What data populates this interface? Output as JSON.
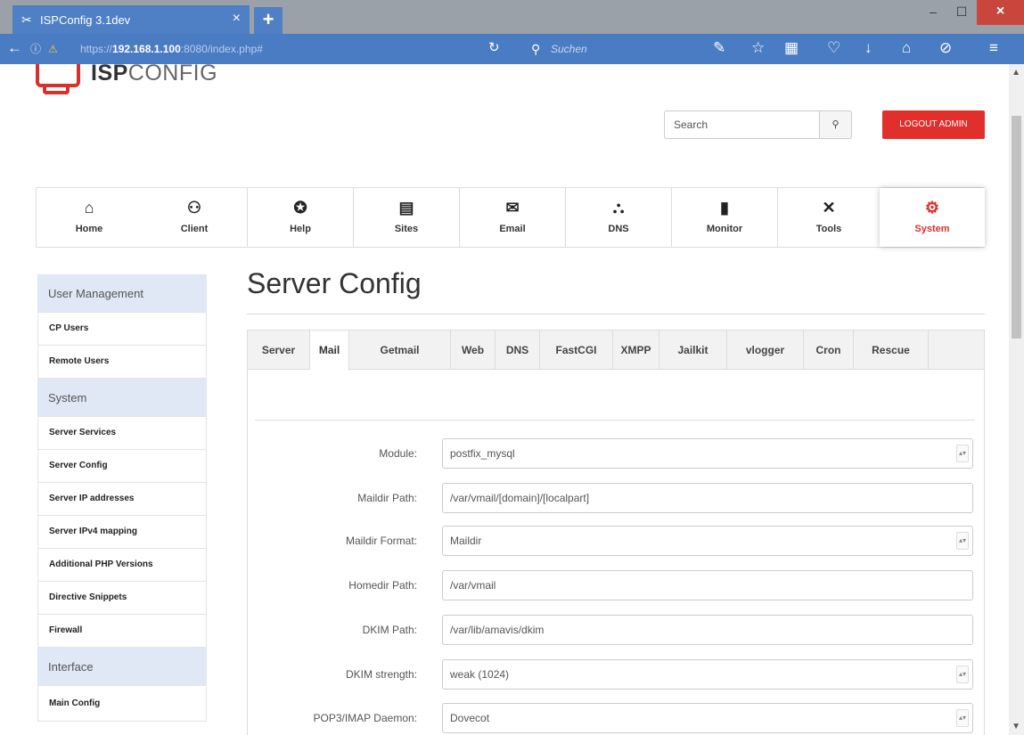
{
  "browser": {
    "tab_title": "ISPConfig 3.1dev",
    "tab_close": "×",
    "new_tab": "+",
    "url": {
      "scheme": "https://",
      "host": "192.168.1.100",
      "path": ":8080/index.php#"
    },
    "search_placeholder": "Suchen",
    "window_controls": {
      "minimize": "–",
      "maximize": "☐",
      "close": "×"
    }
  },
  "header": {
    "logo": {
      "strong": "ISP",
      "light": "CONFIG"
    },
    "search_placeholder": "Search",
    "search_button": "🔍",
    "logout_label": "LOGOUT ADMIN"
  },
  "nav": [
    {
      "label": "Home",
      "icon": "home-icon",
      "glyph": "🏠",
      "active": false
    },
    {
      "label": "Client",
      "icon": "users-icon",
      "glyph": "👥",
      "active": false
    },
    {
      "label": "Help",
      "icon": "lifebuoy-icon",
      "glyph": "✪",
      "active": false
    },
    {
      "label": "Sites",
      "icon": "sites-icon",
      "glyph": "▤",
      "active": false
    },
    {
      "label": "Email",
      "icon": "email-icon",
      "glyph": "✉",
      "active": false
    },
    {
      "label": "DNS",
      "icon": "dns-icon",
      "glyph": "⛬",
      "active": false
    },
    {
      "label": "Monitor",
      "icon": "monitor-icon",
      "glyph": "▮",
      "active": false
    },
    {
      "label": "Tools",
      "icon": "tools-icon",
      "glyph": "✕",
      "active": false
    },
    {
      "label": "System",
      "icon": "gear-icon",
      "glyph": "⚙",
      "active": true
    }
  ],
  "sidebar": {
    "sections": [
      {
        "title": "User Management",
        "items": [
          "CP Users",
          "Remote Users"
        ]
      },
      {
        "title": "System",
        "items": [
          "Server Services",
          "Server Config",
          "Server IP addresses",
          "Server IPv4 mapping",
          "Additional PHP Versions",
          "Directive Snippets",
          "Firewall"
        ]
      },
      {
        "title": "Interface",
        "items": [
          "Main Config"
        ]
      }
    ]
  },
  "main": {
    "title": "Server Config",
    "tabs": [
      "Server",
      "Mail",
      "Getmail",
      "Web",
      "DNS",
      "FastCGI",
      "XMPP",
      "Jailkit",
      "vlogger",
      "Cron",
      "Rescue"
    ],
    "active_tab": "Mail",
    "fields": [
      {
        "label": "Module:",
        "value": "postfix_mysql",
        "type": "select"
      },
      {
        "label": "Maildir Path:",
        "value": "/var/vmail/[domain]/[localpart]",
        "type": "text"
      },
      {
        "label": "Maildir Format:",
        "value": "Maildir",
        "type": "select"
      },
      {
        "label": "Homedir Path:",
        "value": "/var/vmail",
        "type": "text"
      },
      {
        "label": "DKIM Path:",
        "value": "/var/lib/amavis/dkim",
        "type": "text"
      },
      {
        "label": "DKIM strength:",
        "value": "weak (1024)",
        "type": "select"
      },
      {
        "label": "POP3/IMAP Daemon:",
        "value": "Dovecot",
        "type": "select"
      }
    ]
  },
  "colors": {
    "accent": "#d8312c",
    "browser_chrome": "#4a7cc3",
    "sidebar_heading_bg": "#dfe8f4"
  }
}
